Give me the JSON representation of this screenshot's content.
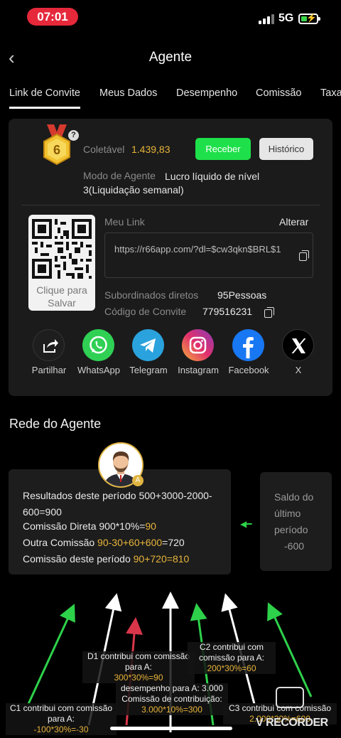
{
  "status_bar": {
    "time": "07:01",
    "network": "5G"
  },
  "header": {
    "title": "Agente",
    "back_icon": "chevron-left-icon"
  },
  "tabs": [
    {
      "label": "Link de Convite",
      "active": true
    },
    {
      "label": "Meus Dados",
      "active": false
    },
    {
      "label": "Desempenho",
      "active": false
    },
    {
      "label": "Comissão",
      "active": false
    },
    {
      "label": "Taxa",
      "active": false
    }
  ],
  "agent_card": {
    "level": "6",
    "help": "?",
    "collectable_label": "Coletável",
    "collectable_value": "1.439,83",
    "receive_button": "Receber",
    "history_button": "Histórico",
    "mode_label": "Modo de Agente",
    "mode_value": "Lucro líquido de nível 3(Liquidação semanal)",
    "qr_caption": "Clique para Salvar",
    "my_link_label": "Meu Link",
    "change_label": "Alterar",
    "link_url": "https://r66app.com/?dl=$cw3qkn$BRL$1",
    "subordinates_label": "Subordinados diretos",
    "subordinates_value": "95Pessoas",
    "invite_code_label": "Código de Convite",
    "invite_code_value": "779516231"
  },
  "share": [
    {
      "label": "Partilhar",
      "icon": "share-icon",
      "color": "#1e1e1e"
    },
    {
      "label": "WhatsApp",
      "icon": "whatsapp-icon",
      "color": "#2fd054"
    },
    {
      "label": "Telegram",
      "icon": "telegram-icon",
      "color": "#2aa2dd"
    },
    {
      "label": "Instagram",
      "icon": "instagram-icon",
      "color": "#d6287a"
    },
    {
      "label": "Facebook",
      "icon": "facebook-icon",
      "color": "#1877f2"
    },
    {
      "label": "X",
      "icon": "x-icon",
      "color": "#000000"
    }
  ],
  "network": {
    "title": "Rede do Agente",
    "avatar_badge": "A",
    "results": {
      "line1": "Resultados deste período 500+3000-2000-600=900",
      "line2_prefix": "Comissão Direta 900*10%=",
      "line2_value": "90",
      "line3_prefix": "Outra Comissão ",
      "line3_a": "90",
      "line3_b": "-30",
      "line3_c": "+60",
      "line3_d": "+600",
      "line3_suffix": "=720",
      "line4_prefix": "Comissão deste período ",
      "line4_a": "90",
      "line4_b": "+720",
      "line4_c": "=810"
    },
    "saldo": {
      "line1": "Saldo do",
      "line2": "último",
      "line3": "período",
      "line4": "-600"
    },
    "notes": {
      "d1_text": "D1 contribui com comissão para A:",
      "d1_value": "300*30%=90",
      "d1_extra1": "desempenho para A: 3.000",
      "d1_extra2": "Comissão de contribuição:",
      "d1_extra3": "3.000*10%=300",
      "c2_text": "C2 contribui com comissão para A:",
      "c2_value": "200*30%=60",
      "c1_text": "C1 contribui com comissão para A:",
      "c1_value": "-100*30%=-30",
      "c3_text": "C3 contribui com comissão",
      "c3_value": "2.000*30%=600"
    }
  },
  "recorder": {
    "label": "V RECORDER"
  }
}
